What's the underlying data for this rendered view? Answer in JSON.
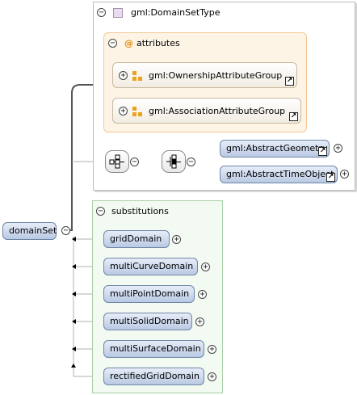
{
  "root": {
    "element_label": "domainSet"
  },
  "type": {
    "label": "gml:DomainSetType"
  },
  "attributes": {
    "label": "attributes",
    "groups": [
      {
        "label": "gml:OwnershipAttributeGroup"
      },
      {
        "label": "gml:AssociationAttributeGroup"
      }
    ]
  },
  "choice": {
    "elements": [
      {
        "label": "gml:AbstractGeometry"
      },
      {
        "label": "gml:AbstractTimeObject"
      }
    ]
  },
  "substitutions": {
    "label": "substitutions",
    "elements": [
      {
        "label": "gridDomain"
      },
      {
        "label": "multiCurveDomain"
      },
      {
        "label": "multiPointDomain"
      },
      {
        "label": "multiSolidDomain"
      },
      {
        "label": "multiSurfaceDomain"
      },
      {
        "label": "rectifiedGridDomain"
      }
    ]
  },
  "symbols": {
    "expand": "+",
    "collapse": "−",
    "link": "↗",
    "attribute_marker": "@"
  },
  "colors": {
    "element_fill": "#c9d6ec",
    "element_border": "#6f86a8",
    "attributes_fill": "#fdf4e6",
    "substitutions_fill": "#f2faf1",
    "type_icon": "#e9dced"
  }
}
